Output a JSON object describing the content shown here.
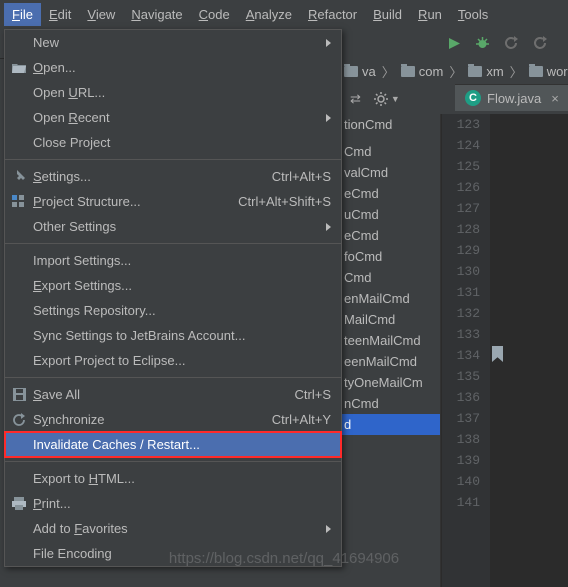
{
  "menubar": {
    "items": [
      "File",
      "Edit",
      "View",
      "Navigate",
      "Code",
      "Analyze",
      "Refactor",
      "Build",
      "Run",
      "Tools"
    ],
    "active_index": 0
  },
  "toolbar": {
    "run_icon": "run-icon",
    "bug_icon": "debug-icon",
    "stop1_icon": "rerun-icon",
    "stop2_icon": "stop-icon"
  },
  "breadcrumbs": {
    "items": [
      "va",
      "com",
      "xm",
      "wor"
    ]
  },
  "subtoolbar": {
    "settings_label": "⚙",
    "gear_icon": "gear-icon"
  },
  "editor_tab": {
    "filename": "Flow.java"
  },
  "gutter": {
    "start": 123,
    "end": 141
  },
  "structure_items": [
    "tionCmd",
    "",
    "Cmd",
    "valCmd",
    "eCmd",
    "uCmd",
    "eCmd",
    "foCmd",
    "Cmd",
    "enMailCmd",
    "MailCmd",
    "teenMailCmd",
    "eenMailCmd",
    "tyOneMailCm",
    "nCmd",
    "d"
  ],
  "structure_last_index": 15,
  "file_menu": {
    "groups": [
      [
        {
          "label": "New",
          "submenu": true
        },
        {
          "label": "Open...",
          "u": 0,
          "icon": "open-icon"
        },
        {
          "label": "Open URL...",
          "u": 5
        },
        {
          "label": "Open Recent",
          "u": 5,
          "submenu": true
        },
        {
          "label": "Close Project"
        }
      ],
      [
        {
          "label": "Settings...",
          "u": 0,
          "shortcut": "Ctrl+Alt+S",
          "icon": "settings-icon"
        },
        {
          "label": "Project Structure...",
          "u": 0,
          "shortcut": "Ctrl+Alt+Shift+S",
          "icon": "project-structure-icon"
        },
        {
          "label": "Other Settings",
          "submenu": true
        }
      ],
      [
        {
          "label": "Import Settings..."
        },
        {
          "label": "Export Settings...",
          "u": 0
        },
        {
          "label": "Settings Repository..."
        },
        {
          "label": "Sync Settings to JetBrains Account..."
        },
        {
          "label": "Export Project to Eclipse..."
        }
      ],
      [
        {
          "label": "Save All",
          "u": 0,
          "shortcut": "Ctrl+S",
          "icon": "save-icon"
        },
        {
          "label": "Synchronize",
          "u": 1,
          "shortcut": "Ctrl+Alt+Y",
          "icon": "sync-icon"
        },
        {
          "label": "Invalidate Caches / Restart...",
          "highlight": true
        }
      ],
      [
        {
          "label": "Export to HTML...",
          "u": 10
        },
        {
          "label": "Print...",
          "u": 0,
          "icon": "print-icon"
        },
        {
          "label": "Add to Favorites",
          "u": 7,
          "submenu": true
        },
        {
          "label": "File Encoding"
        }
      ]
    ]
  },
  "watermark": "https://blog.csdn.net/qq_41694906"
}
